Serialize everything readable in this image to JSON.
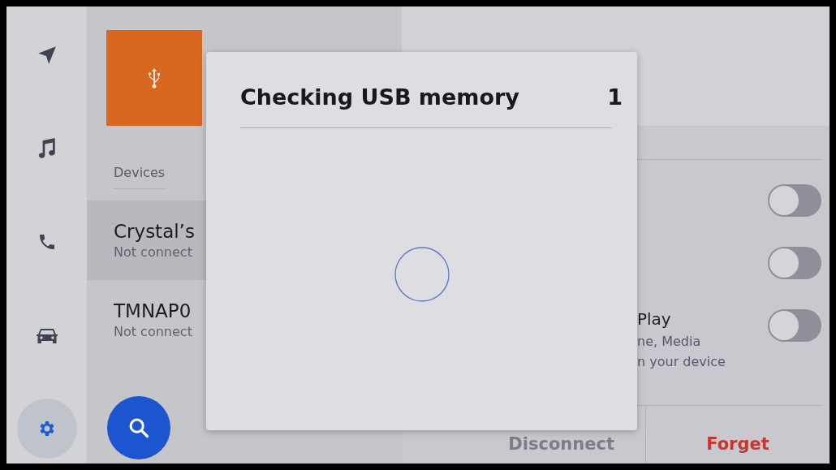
{
  "sidebar": {
    "items": [
      {
        "kind": "navigation",
        "selected": false
      },
      {
        "kind": "music",
        "selected": false
      },
      {
        "kind": "phone",
        "selected": false
      },
      {
        "kind": "car",
        "selected": false
      },
      {
        "kind": "settings",
        "selected": true
      }
    ]
  },
  "devices": {
    "heading": "Devices",
    "items": [
      {
        "name": "Crystal’s",
        "status": "Not connect",
        "selected": true
      },
      {
        "name": "TMNAP0",
        "status": "Not connect",
        "selected": false
      }
    ]
  },
  "device_settings": {
    "toggles": [
      {
        "on": false
      },
      {
        "on": false
      },
      {
        "label": "Play",
        "description": [
          "ne, Media",
          "n your device"
        ],
        "on": false
      }
    ]
  },
  "actions": [
    {
      "label": "Disconnect",
      "disabled": true
    },
    {
      "label": "Forget",
      "disabled": false
    }
  ],
  "dialog": {
    "title": "Checking USB memory",
    "count": "1"
  }
}
